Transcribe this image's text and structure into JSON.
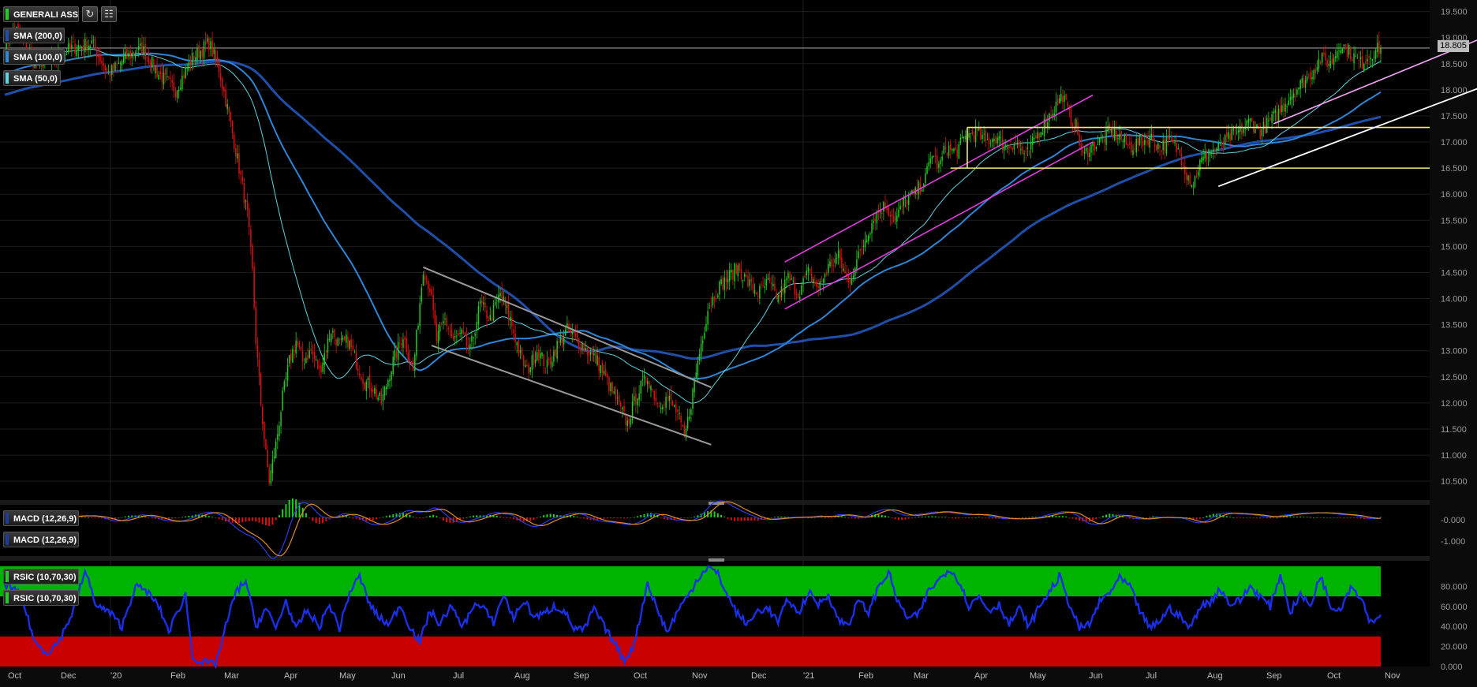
{
  "instrument": "GENERALI ASS",
  "toolbar": {
    "refresh_icon": "refresh-icon",
    "settings_icon": "calculator-icon"
  },
  "last_price": "18.805",
  "indicators": {
    "sma200": {
      "label": "SMA (200,0)",
      "color": "#1f4fa8"
    },
    "sma100": {
      "label": "SMA (100,0)",
      "color": "#2e86d6"
    },
    "sma50": {
      "label": "SMA (50,0)",
      "color": "#5fd3df"
    },
    "macd1": {
      "label": "MACD (12,26,9)",
      "color": "#1e3a9a"
    },
    "macd2": {
      "label": "MACD (12,26,9)",
      "color": "#1e3a9a"
    },
    "rsic1": {
      "label": "RSIC (10,70,30)",
      "color": "#22cc22"
    },
    "rsic2": {
      "label": "RSIC (10,70,30)",
      "color": "#22cc22"
    }
  },
  "chart_data": {
    "type": "candlestick",
    "price_axis": {
      "ticks": [
        "10.500",
        "11.000",
        "11.500",
        "12.000",
        "12.500",
        "13.000",
        "13.500",
        "14.000",
        "14.500",
        "15.000",
        "15.500",
        "16.000",
        "16.500",
        "17.000",
        "17.500",
        "18.000",
        "18.500",
        "19.000",
        "19.500"
      ],
      "range": [
        10.2,
        19.6
      ]
    },
    "macd_axis": {
      "ticks": [
        "-0.000",
        "-1.000"
      ]
    },
    "rsi_axis": {
      "ticks": [
        "80.000",
        "60.000",
        "40.000",
        "20.000",
        "0.000"
      ],
      "range": [
        0,
        100
      ],
      "overbought": 70,
      "oversold": 30
    },
    "x_axis": {
      "ticks": [
        "Oct",
        "Dec",
        "'20",
        "Feb",
        "Mar",
        "Apr",
        "May",
        "Jun",
        "Jul",
        "Aug",
        "Sep",
        "Oct",
        "Nov",
        "Dec",
        "'21",
        "Feb",
        "Mar",
        "Apr",
        "May",
        "Jun",
        "Jul",
        "Aug",
        "Sep",
        "Oct",
        "Nov"
      ]
    },
    "price_anchors": [
      [
        0,
        18.8
      ],
      [
        6,
        19.2
      ],
      [
        18,
        18.5
      ],
      [
        30,
        18.6
      ],
      [
        40,
        18.8
      ],
      [
        52,
        18.9
      ],
      [
        62,
        18.3
      ],
      [
        72,
        18.6
      ],
      [
        82,
        18.8
      ],
      [
        92,
        18.3
      ],
      [
        102,
        18.0
      ],
      [
        112,
        18.6
      ],
      [
        122,
        18.9
      ],
      [
        128,
        18.4
      ],
      [
        134,
        17.5
      ],
      [
        140,
        16.5
      ],
      [
        145,
        15.6
      ],
      [
        148,
        14.5
      ],
      [
        150,
        13.2
      ],
      [
        153,
        12.0
      ],
      [
        156,
        11.0
      ],
      [
        158,
        10.5
      ],
      [
        162,
        11.2
      ],
      [
        166,
        12.1
      ],
      [
        170,
        12.8
      ],
      [
        174,
        13.2
      ],
      [
        178,
        12.8
      ],
      [
        183,
        13.0
      ],
      [
        188,
        12.6
      ],
      [
        195,
        13.4
      ],
      [
        200,
        13.1
      ],
      [
        205,
        13.2
      ],
      [
        210,
        12.8
      ],
      [
        215,
        12.4
      ],
      [
        220,
        12.3
      ],
      [
        225,
        12.0
      ],
      [
        232,
        12.8
      ],
      [
        238,
        13.3
      ],
      [
        244,
        12.6
      ],
      [
        250,
        14.6
      ],
      [
        254,
        14.2
      ],
      [
        258,
        13.2
      ],
      [
        263,
        13.6
      ],
      [
        268,
        13.2
      ],
      [
        273,
        13.3
      ],
      [
        278,
        13.0
      ],
      [
        284,
        13.9
      ],
      [
        290,
        13.6
      ],
      [
        296,
        14.1
      ],
      [
        302,
        13.6
      ],
      [
        308,
        12.9
      ],
      [
        312,
        12.6
      ],
      [
        318,
        13.0
      ],
      [
        324,
        12.7
      ],
      [
        330,
        13.1
      ],
      [
        336,
        13.4
      ],
      [
        342,
        13.2
      ],
      [
        348,
        13.0
      ],
      [
        354,
        12.8
      ],
      [
        360,
        12.4
      ],
      [
        366,
        12.0
      ],
      [
        372,
        11.6
      ],
      [
        378,
        12.2
      ],
      [
        384,
        12.5
      ],
      [
        390,
        12.0
      ],
      [
        396,
        12.1
      ],
      [
        402,
        11.8
      ],
      [
        406,
        11.3
      ],
      [
        410,
        12.0
      ],
      [
        414,
        12.8
      ],
      [
        420,
        13.8
      ],
      [
        426,
        14.2
      ],
      [
        432,
        14.4
      ],
      [
        438,
        14.6
      ],
      [
        444,
        14.3
      ],
      [
        450,
        14.1
      ],
      [
        456,
        14.3
      ],
      [
        462,
        14.0
      ],
      [
        468,
        14.4
      ],
      [
        474,
        14.1
      ],
      [
        480,
        14.5
      ],
      [
        486,
        14.2
      ],
      [
        492,
        14.6
      ],
      [
        498,
        14.8
      ],
      [
        504,
        14.3
      ],
      [
        510,
        14.8
      ],
      [
        516,
        15.3
      ],
      [
        520,
        15.6
      ],
      [
        526,
        15.8
      ],
      [
        532,
        15.5
      ],
      [
        538,
        15.9
      ],
      [
        544,
        16.0
      ],
      [
        550,
        16.3
      ],
      [
        554,
        16.8
      ],
      [
        558,
        16.5
      ],
      [
        562,
        16.9
      ],
      [
        568,
        16.8
      ],
      [
        574,
        17.1
      ],
      [
        580,
        17.2
      ],
      [
        586,
        17.0
      ],
      [
        592,
        17.1
      ],
      [
        598,
        16.9
      ],
      [
        604,
        17.0
      ],
      [
        610,
        16.7
      ],
      [
        616,
        17.1
      ],
      [
        622,
        17.4
      ],
      [
        628,
        17.7
      ],
      [
        632,
        17.9
      ],
      [
        636,
        17.5
      ],
      [
        640,
        17.3
      ],
      [
        644,
        16.7
      ],
      [
        648,
        16.9
      ],
      [
        654,
        17.0
      ],
      [
        660,
        17.2
      ],
      [
        666,
        17.1
      ],
      [
        672,
        16.9
      ],
      [
        678,
        17.0
      ],
      [
        684,
        17.1
      ],
      [
        690,
        16.9
      ],
      [
        696,
        17.0
      ],
      [
        702,
        16.8
      ],
      [
        706,
        16.4
      ],
      [
        710,
        16.2
      ],
      [
        714,
        16.6
      ],
      [
        720,
        16.8
      ],
      [
        726,
        16.9
      ],
      [
        732,
        17.1
      ],
      [
        738,
        17.2
      ],
      [
        744,
        17.4
      ],
      [
        750,
        17.2
      ],
      [
        756,
        17.4
      ],
      [
        762,
        17.6
      ],
      [
        768,
        17.9
      ],
      [
        774,
        18.1
      ],
      [
        780,
        18.3
      ],
      [
        786,
        18.6
      ],
      [
        792,
        18.5
      ],
      [
        798,
        18.9
      ],
      [
        804,
        18.7
      ],
      [
        810,
        18.5
      ],
      [
        816,
        18.7
      ],
      [
        822,
        18.8
      ]
    ],
    "sma_lines": "moving averages of the price series (50, 100, 200 periods)",
    "rsi_anchors": [
      [
        0,
        83
      ],
      [
        10,
        70
      ],
      [
        18,
        24
      ],
      [
        25,
        14
      ],
      [
        32,
        24
      ],
      [
        40,
        52
      ],
      [
        48,
        95
      ],
      [
        55,
        60
      ],
      [
        62,
        55
      ],
      [
        70,
        40
      ],
      [
        78,
        80
      ],
      [
        85,
        75
      ],
      [
        92,
        60
      ],
      [
        98,
        35
      ],
      [
        108,
        72
      ],
      [
        112,
        10
      ],
      [
        118,
        4
      ],
      [
        126,
        2
      ],
      [
        132,
        40
      ],
      [
        138,
        74
      ],
      [
        144,
        86
      ],
      [
        150,
        40
      ],
      [
        156,
        58
      ],
      [
        162,
        38
      ],
      [
        168,
        66
      ],
      [
        174,
        36
      ],
      [
        180,
        56
      ],
      [
        188,
        40
      ],
      [
        194,
        62
      ],
      [
        200,
        38
      ],
      [
        206,
        74
      ],
      [
        212,
        90
      ],
      [
        218,
        62
      ],
      [
        224,
        48
      ],
      [
        230,
        42
      ],
      [
        236,
        62
      ],
      [
        242,
        40
      ],
      [
        248,
        24
      ],
      [
        254,
        56
      ],
      [
        260,
        42
      ],
      [
        266,
        60
      ],
      [
        274,
        40
      ],
      [
        280,
        62
      ],
      [
        286,
        58
      ],
      [
        292,
        44
      ],
      [
        298,
        72
      ],
      [
        304,
        48
      ],
      [
        310,
        66
      ],
      [
        316,
        50
      ],
      [
        322,
        52
      ],
      [
        328,
        60
      ],
      [
        334,
        56
      ],
      [
        340,
        38
      ],
      [
        346,
        36
      ],
      [
        352,
        58
      ],
      [
        358,
        40
      ],
      [
        364,
        24
      ],
      [
        370,
        6
      ],
      [
        376,
        22
      ],
      [
        384,
        84
      ],
      [
        390,
        56
      ],
      [
        396,
        34
      ],
      [
        402,
        56
      ],
      [
        408,
        70
      ],
      [
        414,
        88
      ],
      [
        420,
        100
      ],
      [
        426,
        92
      ],
      [
        432,
        70
      ],
      [
        438,
        52
      ],
      [
        444,
        42
      ],
      [
        450,
        56
      ],
      [
        456,
        58
      ],
      [
        462,
        44
      ],
      [
        468,
        68
      ],
      [
        474,
        52
      ],
      [
        480,
        74
      ],
      [
        486,
        62
      ],
      [
        492,
        72
      ],
      [
        498,
        46
      ],
      [
        504,
        42
      ],
      [
        510,
        66
      ],
      [
        516,
        54
      ],
      [
        522,
        80
      ],
      [
        528,
        94
      ],
      [
        534,
        62
      ],
      [
        540,
        48
      ],
      [
        546,
        52
      ],
      [
        552,
        76
      ],
      [
        558,
        86
      ],
      [
        564,
        98
      ],
      [
        570,
        86
      ],
      [
        576,
        60
      ],
      [
        582,
        70
      ],
      [
        588,
        56
      ],
      [
        594,
        62
      ],
      [
        600,
        42
      ],
      [
        606,
        58
      ],
      [
        612,
        40
      ],
      [
        618,
        60
      ],
      [
        624,
        74
      ],
      [
        630,
        90
      ],
      [
        636,
        62
      ],
      [
        642,
        38
      ],
      [
        648,
        42
      ],
      [
        654,
        64
      ],
      [
        660,
        74
      ],
      [
        666,
        88
      ],
      [
        672,
        80
      ],
      [
        678,
        56
      ],
      [
        684,
        38
      ],
      [
        690,
        46
      ],
      [
        696,
        58
      ],
      [
        702,
        50
      ],
      [
        708,
        38
      ],
      [
        714,
        60
      ],
      [
        720,
        64
      ],
      [
        726,
        78
      ],
      [
        732,
        62
      ],
      [
        738,
        66
      ],
      [
        744,
        80
      ],
      [
        750,
        70
      ],
      [
        756,
        60
      ],
      [
        762,
        92
      ],
      [
        768,
        54
      ],
      [
        774,
        72
      ],
      [
        780,
        60
      ],
      [
        786,
        92
      ],
      [
        792,
        60
      ],
      [
        798,
        58
      ],
      [
        804,
        80
      ],
      [
        810,
        70
      ],
      [
        816,
        44
      ],
      [
        822,
        52
      ]
    ],
    "trend_lines": {
      "channel_2020": "grey descending channel (Jun–Nov 2020)",
      "channel_2021_magenta": "magenta ascending channel (Nov 2020–May 2021)",
      "range_yellow": [
        16.5,
        17.3
      ],
      "channel_2021_white": "white/pink ascending channel (Aug–Nov 2021)",
      "resistance_grey": 18.8
    },
    "colors": {
      "up": "#22cc22",
      "down": "#dd1111",
      "grid": "#1c1c1c",
      "rsi_upper": "#00b300",
      "rsi_lower": "#c80000",
      "rsi_line": "#1a2fe8"
    }
  }
}
